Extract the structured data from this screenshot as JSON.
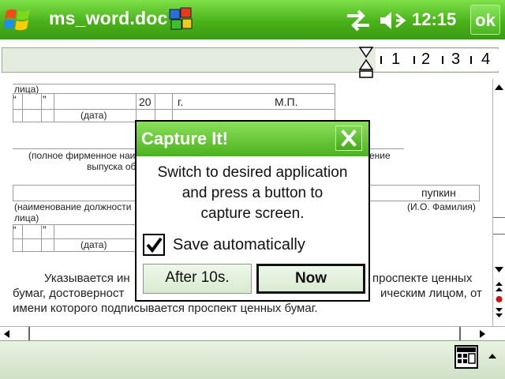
{
  "taskbar": {
    "title": "ms_word.doc",
    "time": "12:15",
    "ok_label": "ok"
  },
  "ruler": {
    "numbers": [
      "1",
      "2",
      "3",
      "4"
    ]
  },
  "document": {
    "row1_left": "лица)",
    "q_open": "“",
    "q_close": "”",
    "year_prefix": "20",
    "year_suffix": "г.",
    "stamp": "М.П.",
    "date_label": "(дата)",
    "company_label": "(полное фирменное наи",
    "company_label2": "выпуска об",
    "company_right": "ение",
    "position_label": "(наименование должности",
    "position_label2": "лица)",
    "signer_name": "пупкин",
    "signer_label": "(И.О. Фамилия)",
    "date_label2": "(дата)",
    "para_line1_left": "Указывается ин",
    "para_line1_right": "проспекте ценных",
    "para_line2_left": "бумаг, достоверност",
    "para_line2_right": "ическим лицом, от",
    "para_line3": "имени которого подписывается проспект ценных бумаг."
  },
  "dialog": {
    "title": "Capture It!",
    "message_line1": "Switch to desired application",
    "message_line2": "and press a button to",
    "message_line3": "capture screen.",
    "checkbox_label": "Save automatically",
    "checkbox_checked": true,
    "btn_after": "After 10s.",
    "btn_now": "Now"
  },
  "colors": {
    "titlebar_green": "#49b21a",
    "dialog_green": "#4cb11e",
    "bottombar": "#d8e8d0"
  }
}
